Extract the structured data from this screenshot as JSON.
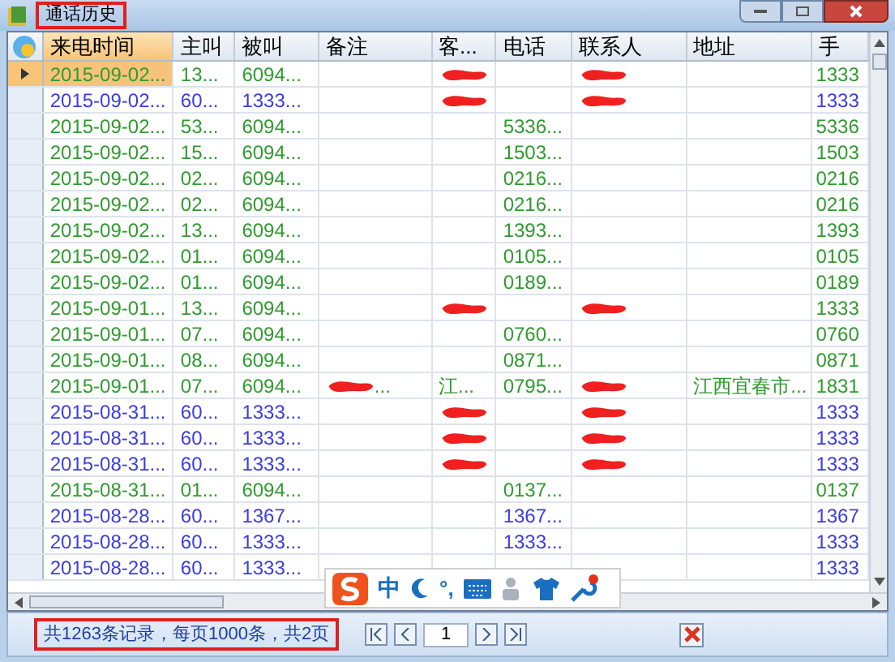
{
  "window": {
    "title": "通话历史"
  },
  "table": {
    "columns": [
      {
        "label": "来电时间",
        "selected": true
      },
      {
        "label": "主叫",
        "selected": false
      },
      {
        "label": "被叫",
        "selected": false
      },
      {
        "label": "备注",
        "selected": false
      },
      {
        "label": "客...",
        "selected": false
      },
      {
        "label": "电话",
        "selected": false
      },
      {
        "label": "联系人",
        "selected": false
      },
      {
        "label": "地址",
        "selected": false
      },
      {
        "label": "手",
        "selected": false
      }
    ],
    "rows": [
      {
        "selected": true,
        "color": "#2e9b2e",
        "cells": [
          "2015-09-02...",
          "13...",
          "6094...",
          null,
          {
            "redacted": true
          },
          null,
          {
            "redacted": true
          },
          null,
          "1333"
        ]
      },
      {
        "selected": false,
        "color": "#3b3be6",
        "cells": [
          "2015-09-02...",
          "60...",
          "1333...",
          null,
          {
            "redacted": true
          },
          null,
          {
            "redacted": true
          },
          null,
          "1333"
        ]
      },
      {
        "selected": false,
        "color": "#2e9b2e",
        "cells": [
          "2015-09-02...",
          "53...",
          "6094...",
          null,
          null,
          "5336...",
          null,
          null,
          "5336"
        ]
      },
      {
        "selected": false,
        "color": "#2e9b2e",
        "cells": [
          "2015-09-02...",
          "15...",
          "6094...",
          null,
          null,
          "1503...",
          null,
          null,
          "1503"
        ]
      },
      {
        "selected": false,
        "color": "#2e9b2e",
        "cells": [
          "2015-09-02...",
          "02...",
          "6094...",
          null,
          null,
          "0216...",
          null,
          null,
          "0216"
        ]
      },
      {
        "selected": false,
        "color": "#2e9b2e",
        "cells": [
          "2015-09-02...",
          "02...",
          "6094...",
          null,
          null,
          "0216...",
          null,
          null,
          "0216"
        ]
      },
      {
        "selected": false,
        "color": "#2e9b2e",
        "cells": [
          "2015-09-02...",
          "13...",
          "6094...",
          null,
          null,
          "1393...",
          null,
          null,
          "1393"
        ]
      },
      {
        "selected": false,
        "color": "#2e9b2e",
        "cells": [
          "2015-09-02...",
          "01...",
          "6094...",
          null,
          null,
          "0105...",
          null,
          null,
          "0105"
        ]
      },
      {
        "selected": false,
        "color": "#2e9b2e",
        "cells": [
          "2015-09-02...",
          "01...",
          "6094...",
          null,
          null,
          "0189...",
          null,
          null,
          "0189"
        ]
      },
      {
        "selected": false,
        "color": "#2e9b2e",
        "cells": [
          "2015-09-01...",
          "13...",
          "6094...",
          null,
          {
            "redacted": true
          },
          null,
          {
            "redacted": true
          },
          null,
          "1333"
        ]
      },
      {
        "selected": false,
        "color": "#2e9b2e",
        "cells": [
          "2015-09-01...",
          "07...",
          "6094...",
          null,
          null,
          "0760...",
          null,
          null,
          "0760"
        ]
      },
      {
        "selected": false,
        "color": "#2e9b2e",
        "cells": [
          "2015-09-01...",
          "08...",
          "6094...",
          null,
          null,
          "0871...",
          null,
          null,
          "0871"
        ]
      },
      {
        "selected": false,
        "color": "#2e9b2e",
        "cells": [
          "2015-09-01...",
          "07...",
          "6094...",
          {
            "redacted": true,
            "text": "..."
          },
          "江...",
          "0795...",
          {
            "redacted": true
          },
          "江西宜春市...",
          "1831"
        ]
      },
      {
        "selected": false,
        "color": "#3b3be6",
        "cells": [
          "2015-08-31...",
          "60...",
          "1333...",
          null,
          {
            "redacted": true
          },
          null,
          {
            "redacted": true
          },
          null,
          "1333"
        ]
      },
      {
        "selected": false,
        "color": "#3b3be6",
        "cells": [
          "2015-08-31...",
          "60...",
          "1333...",
          null,
          {
            "redacted": true
          },
          null,
          {
            "redacted": true
          },
          null,
          "1333"
        ]
      },
      {
        "selected": false,
        "color": "#3b3be6",
        "cells": [
          "2015-08-31...",
          "60...",
          "1333...",
          null,
          {
            "redacted": true
          },
          null,
          {
            "redacted": true
          },
          null,
          "1333"
        ]
      },
      {
        "selected": false,
        "color": "#2e9b2e",
        "cells": [
          "2015-08-31...",
          "01...",
          "6094...",
          null,
          null,
          "0137...",
          null,
          null,
          "0137"
        ]
      },
      {
        "selected": false,
        "color": "#3b3be6",
        "cells": [
          "2015-08-28...",
          "60...",
          "1367...",
          null,
          null,
          "1367...",
          null,
          null,
          "1367"
        ]
      },
      {
        "selected": false,
        "color": "#3b3be6",
        "cells": [
          "2015-08-28...",
          "60...",
          "1333...",
          null,
          null,
          "1333...",
          null,
          null,
          "1333"
        ]
      },
      {
        "selected": false,
        "color": "#3b3be6",
        "cells": [
          "2015-08-28...",
          "60...",
          "1333...",
          null,
          null,
          null,
          null,
          null,
          "1333"
        ]
      }
    ]
  },
  "ime": {
    "labels": [
      "中",
      "°,"
    ]
  },
  "status_bar": {
    "summary": "共1263条记录，每页1000条，共2页",
    "page": "1"
  }
}
